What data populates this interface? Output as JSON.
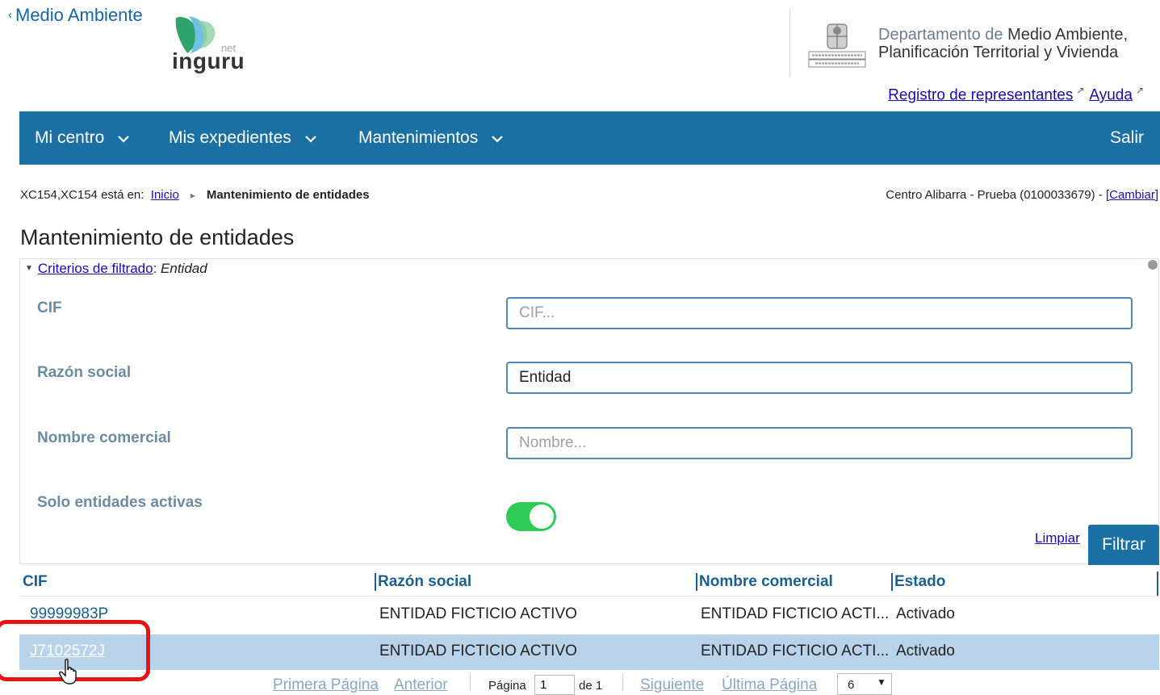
{
  "header": {
    "back_label": "Medio Ambiente",
    "logo_net": "net",
    "logo_word": "inguru",
    "dept_prefix": "Departamento de ",
    "dept_line1": "Medio Ambiente,",
    "dept_line2": "Planificación Territorial y Vivienda",
    "link_registro": "Registro de representantes",
    "link_ayuda": "Ayuda"
  },
  "nav": {
    "items": [
      "Mi centro",
      "Mis expedientes",
      "Mantenimientos"
    ],
    "salir": "Salir"
  },
  "breadcrumb": {
    "prefix": "XC154,XC154 está en:",
    "home": "Inicio",
    "current": "Mantenimiento de entidades",
    "centro": "Centro Alibarra - Prueba (0100033679) - ",
    "cambiar": "[Cambiar]"
  },
  "page_title": "Mantenimiento de entidades",
  "filter": {
    "criteria_link": "Criterios de filtrado",
    "criteria_value": "Entidad",
    "cif_label": "CIF",
    "cif_placeholder": "CIF...",
    "razon_label": "Razón social",
    "razon_value": "Entidad",
    "nombre_label": "Nombre comercial",
    "nombre_placeholder": "Nombre...",
    "activas_label": "Solo entidades activas",
    "activas_on": true,
    "limpiar": "Limpiar",
    "filtrar": "Filtrar"
  },
  "table": {
    "headers": [
      "CIF",
      "Razón social",
      "Nombre comercial",
      "Estado"
    ],
    "rows": [
      {
        "cif": "99999983P",
        "razon": "ENTIDAD FICTICIO ACTIVO",
        "nombre": "ENTIDAD FICTICIO ACTI...",
        "estado": "Activado",
        "selected": false
      },
      {
        "cif": "J7102572J",
        "razon": "ENTIDAD FICTICIO ACTIVO",
        "nombre": "ENTIDAD FICTICIO ACTI...",
        "estado": "Activado",
        "selected": true
      }
    ]
  },
  "pagination": {
    "first": "Primera Página",
    "prev": "Anterior",
    "page_label": "Página",
    "page_value": "1",
    "of_label": "de 1",
    "next": "Siguiente",
    "last": "Última Página",
    "page_size": "6"
  },
  "colors": {
    "nav_bg": "#1a6fa3",
    "toggle_on": "#2ecc57",
    "selected_row": "#b9d3ea",
    "highlight_box": "#e41414"
  }
}
